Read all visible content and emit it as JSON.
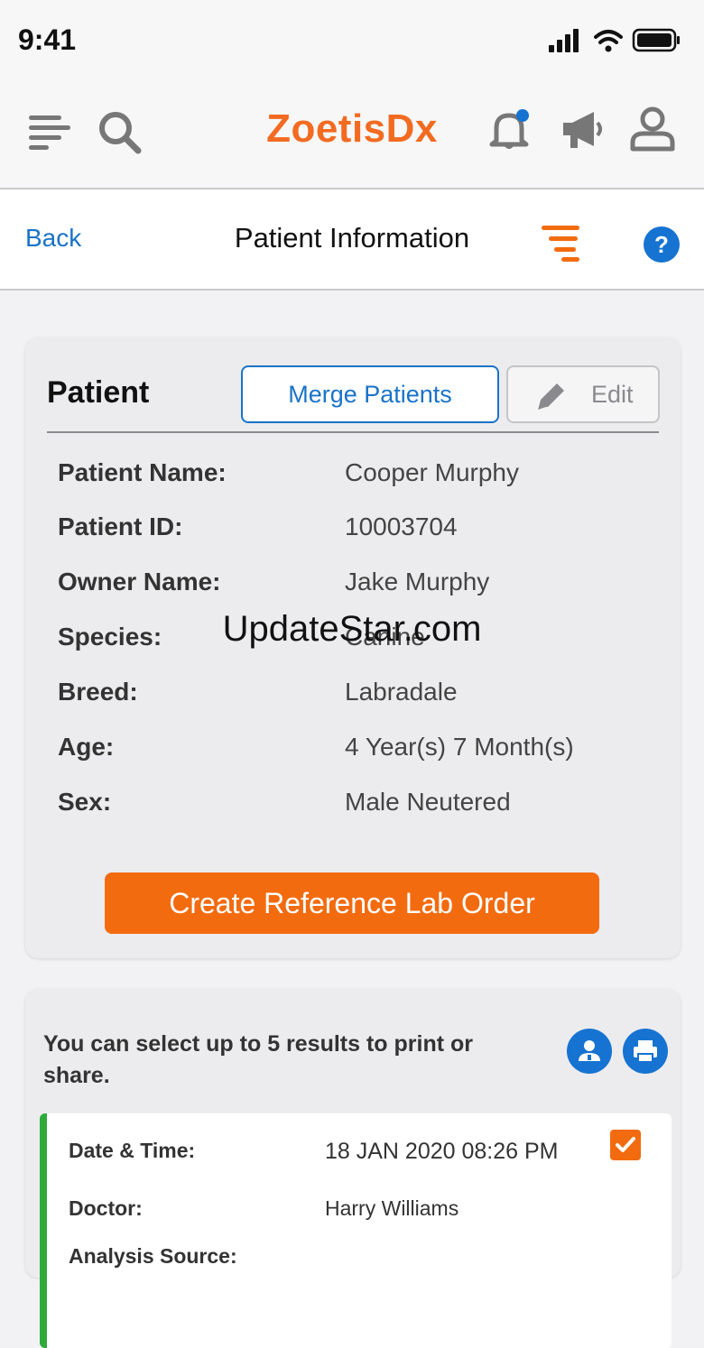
{
  "status_bar": {
    "time": "9:41"
  },
  "header": {
    "logo_text": "ZoetisDx",
    "icons": [
      "menu-icon",
      "search-icon",
      "bell-icon",
      "megaphone-icon",
      "user-icon"
    ],
    "brand_color": "#f26b21",
    "notification_dot_color": "#1673d1"
  },
  "nav": {
    "back_label": "Back",
    "title": "Patient Information",
    "icons": [
      "filter-icon",
      "help-icon"
    ]
  },
  "patient_card": {
    "title": "Patient",
    "merge_label": "Merge Patients",
    "edit_label": "Edit",
    "fields": [
      {
        "label": "Patient Name:",
        "value": "Cooper Murphy"
      },
      {
        "label": "Patient ID:",
        "value": "10003704"
      },
      {
        "label": "Owner Name:",
        "value": "Jake Murphy"
      },
      {
        "label": "Species:",
        "value": "Canine"
      },
      {
        "label": "Breed:",
        "value": "Labradale"
      },
      {
        "label": "Age:",
        "value": "4 Year(s) 7 Month(s)"
      },
      {
        "label": "Sex:",
        "value": "Male Neutered"
      }
    ],
    "cta_label": "Create Reference Lab Order",
    "cta_color": "#f36b0f"
  },
  "watermark": "UpdateStar.com",
  "results": {
    "note": "You can select up to 5 results to print or share.",
    "action_icons": [
      "doctor-share-icon",
      "printer-icon"
    ],
    "accent_color": "#2eaa3c",
    "item": {
      "rows": [
        {
          "label": "Date & Time:",
          "value": "18 JAN 2020 08:26 PM"
        },
        {
          "label": "Doctor:",
          "value": "Harry Williams"
        },
        {
          "label": "Analysis Source:",
          "value": ""
        }
      ],
      "selected": true
    }
  }
}
